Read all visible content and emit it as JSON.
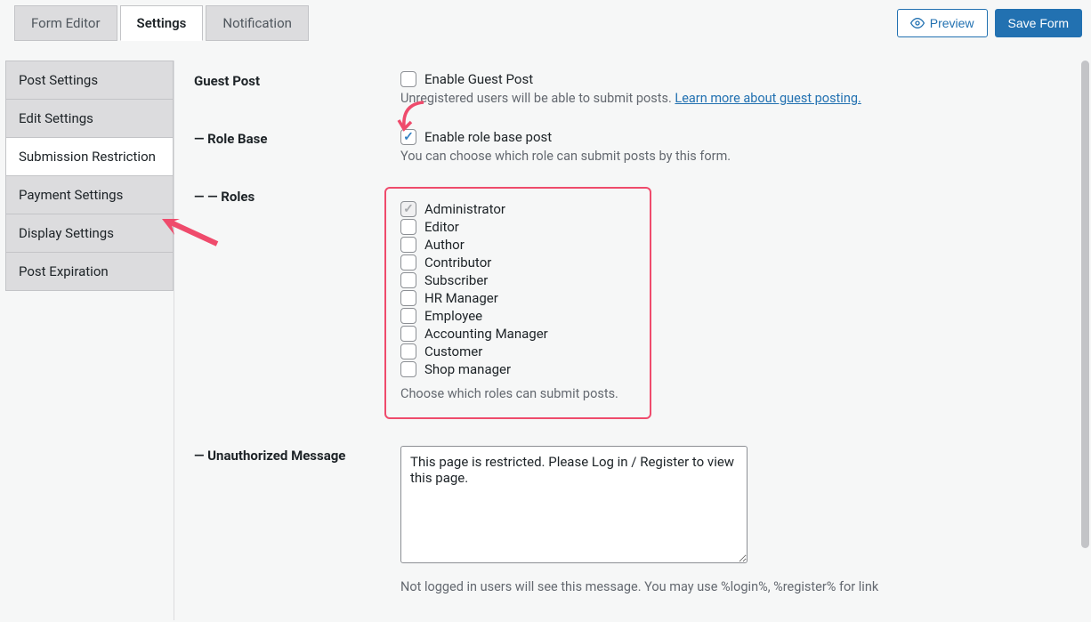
{
  "tabs": [
    {
      "label": "Form Editor",
      "active": false
    },
    {
      "label": "Settings",
      "active": true
    },
    {
      "label": "Notification",
      "active": false
    }
  ],
  "actions": {
    "preview": "Preview",
    "save": "Save Form"
  },
  "sidebar": {
    "items": [
      {
        "label": "Post Settings",
        "active": false
      },
      {
        "label": "Edit Settings",
        "active": false
      },
      {
        "label": "Submission Restriction",
        "active": true
      },
      {
        "label": "Payment Settings",
        "active": false
      },
      {
        "label": "Display Settings",
        "active": false
      },
      {
        "label": "Post Expiration",
        "active": false
      }
    ]
  },
  "sections": {
    "guest_post": {
      "title": "Guest Post",
      "enable_label": "Enable Guest Post",
      "enabled": false,
      "help_prefix": "Unregistered users will be able to submit posts. ",
      "link_text": "Learn more about guest posting."
    },
    "role_base": {
      "title": "— Role Base",
      "enable_label": "Enable role base post",
      "enabled": true,
      "help": "You can choose which role can submit posts by this form."
    },
    "roles": {
      "title": "— — Roles",
      "items": [
        {
          "label": "Administrator",
          "checked": true,
          "disabled": true
        },
        {
          "label": "Editor",
          "checked": false,
          "disabled": false
        },
        {
          "label": "Author",
          "checked": false,
          "disabled": false
        },
        {
          "label": "Contributor",
          "checked": false,
          "disabled": false
        },
        {
          "label": "Subscriber",
          "checked": false,
          "disabled": false
        },
        {
          "label": "HR Manager",
          "checked": false,
          "disabled": false
        },
        {
          "label": "Employee",
          "checked": false,
          "disabled": false
        },
        {
          "label": "Accounting Manager",
          "checked": false,
          "disabled": false
        },
        {
          "label": "Customer",
          "checked": false,
          "disabled": false
        },
        {
          "label": "Shop manager",
          "checked": false,
          "disabled": false
        }
      ],
      "help": "Choose which roles can submit posts."
    },
    "unauthorized": {
      "title": "— Unauthorized Message",
      "value": "This page is restricted. Please Log in / Register to view this page.",
      "help": "Not logged in users will see this message. You may use %login%, %register% for link"
    }
  },
  "colors": {
    "accent": "#2271b1",
    "highlight": "#ef4b6c"
  }
}
